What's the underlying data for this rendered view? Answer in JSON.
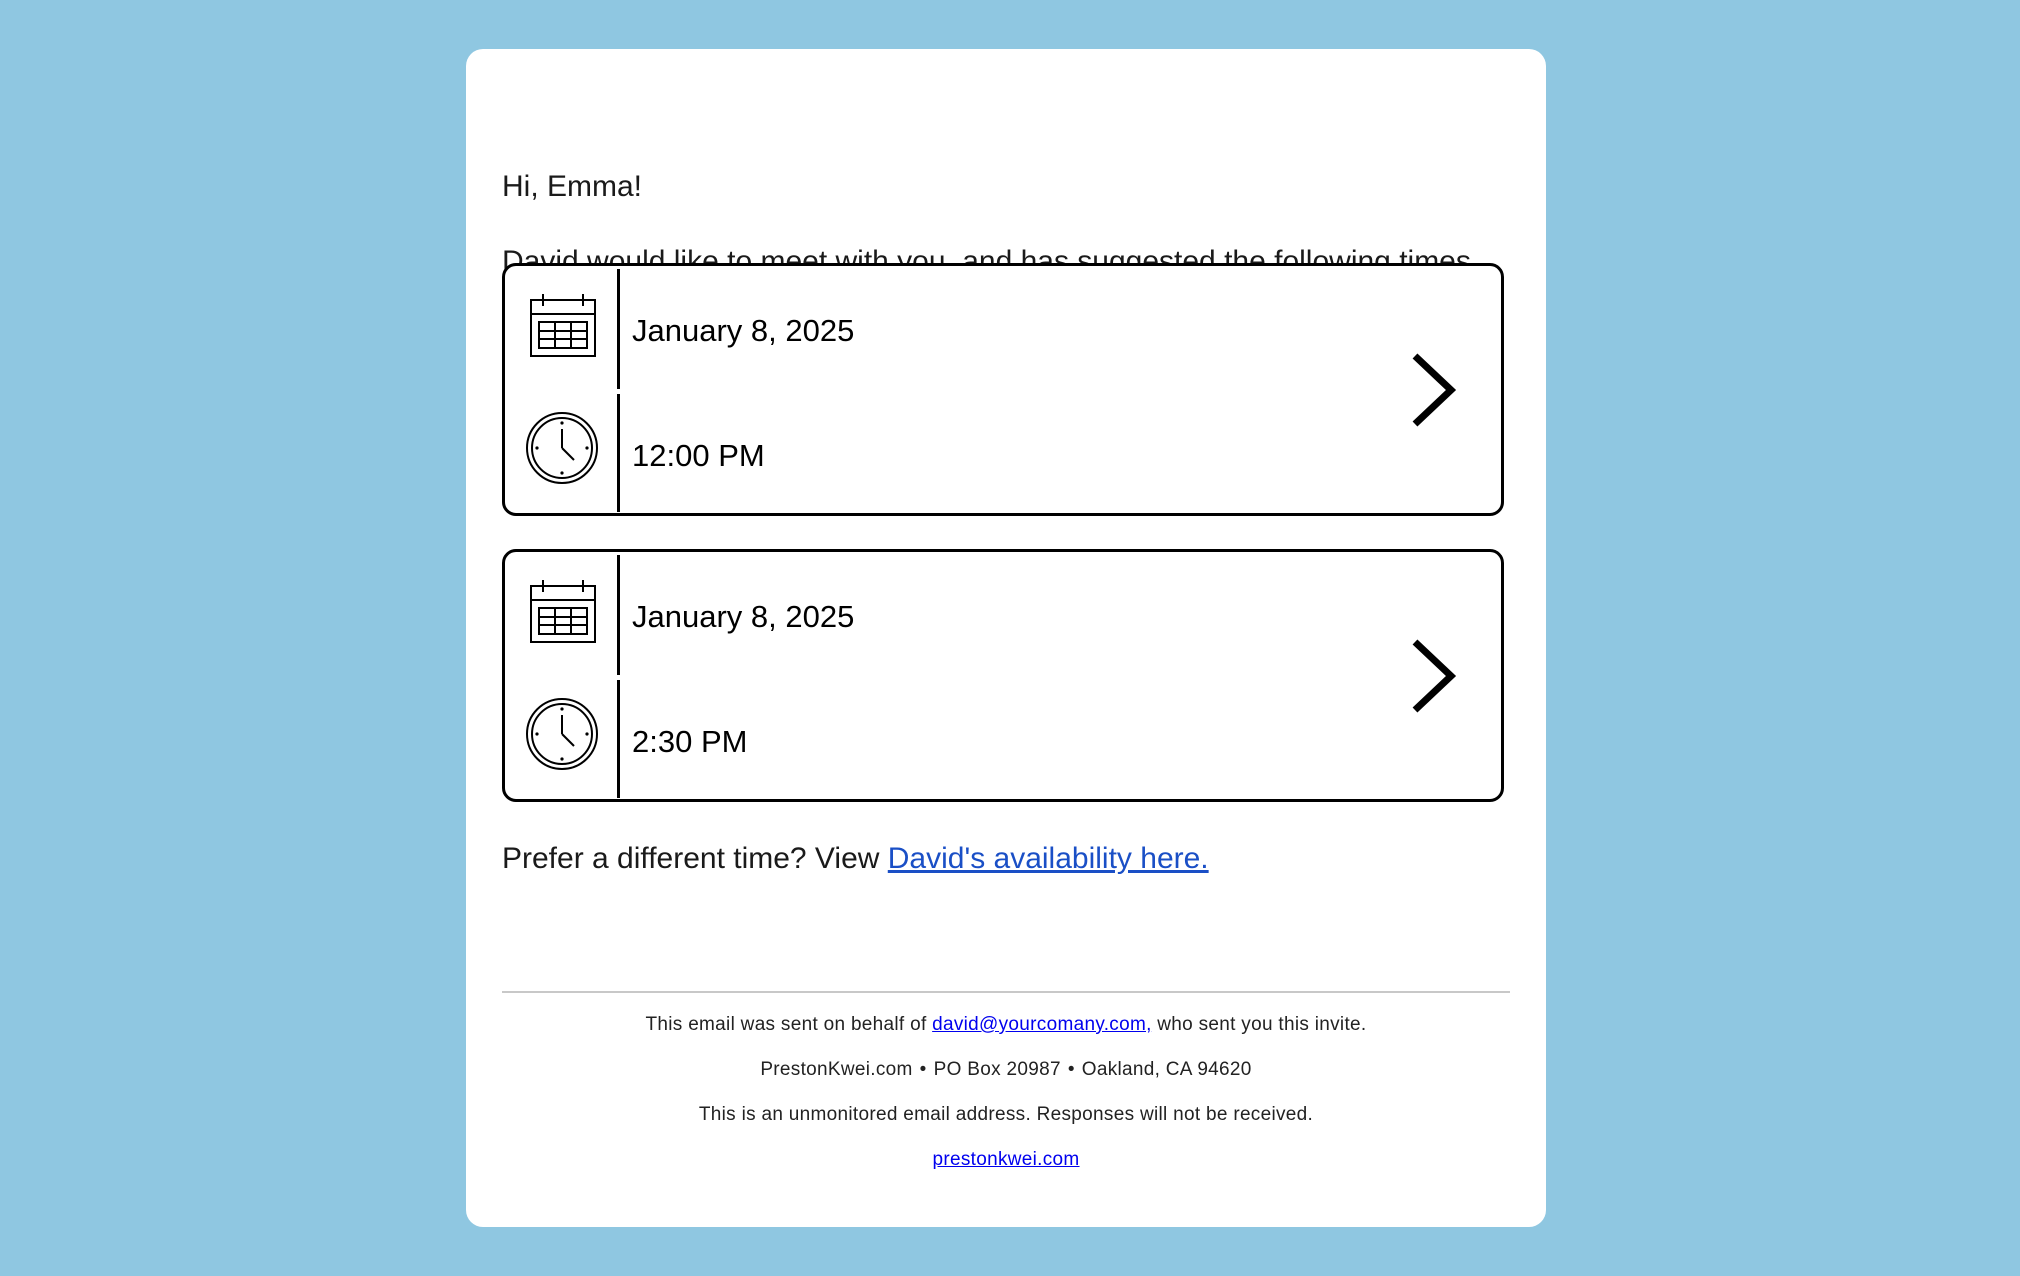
{
  "email": {
    "greeting": "Hi, Emma!",
    "intro": "David would like to meet with you, and has suggested the following times.",
    "slots": [
      {
        "date": "January 8, 2025",
        "time": "12:00 PM"
      },
      {
        "date": "January 8, 2025",
        "time": "2:30 PM"
      }
    ],
    "prefer_text": "Prefer a different time? View ",
    "availability_link": "David's availability here."
  },
  "footer": {
    "sent_prefix": "This email was sent on behalf of ",
    "sender_email": "david@yourcomany.com,",
    "sent_suffix": " who sent you this invite.",
    "company": "PrestonKwei.com",
    "separator": "•",
    "po_box": "PO Box 20987",
    "city": "Oakland, CA 94620",
    "unmonitored": "This is an unmonitored email address. Responses will not be received.",
    "site_link": "prestonkwei.com"
  },
  "colors": {
    "background": "#8fc7e1",
    "link": "#1a4fc6"
  },
  "icons": [
    "calendar-icon",
    "clock-icon",
    "chevron-right-icon"
  ]
}
